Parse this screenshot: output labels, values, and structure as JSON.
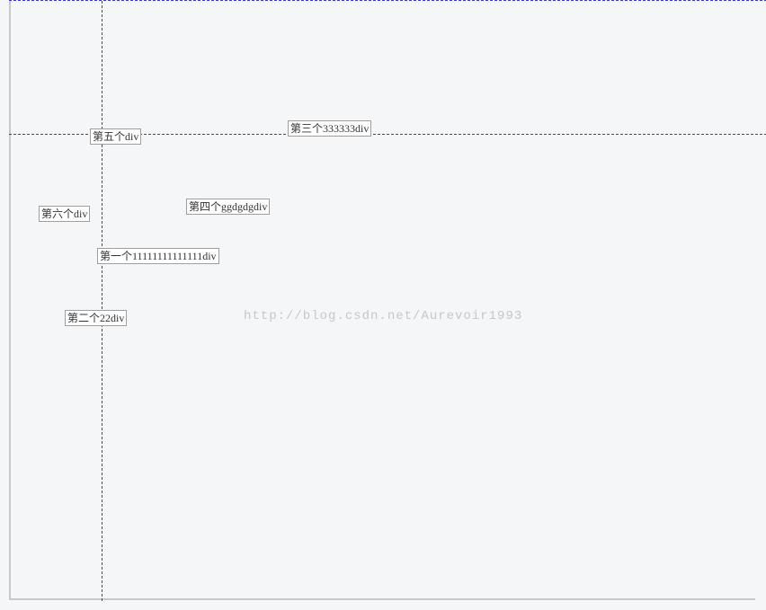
{
  "boxes": {
    "box3": "第三个333333div",
    "box5": "第五个div",
    "box4": "第四个ggdgdgdiv",
    "box6": "第六个div",
    "box1": "第一个11111111111111div",
    "box2": "第二个22div"
  },
  "watermark": "http://blog.csdn.net/Aurevoir1993"
}
